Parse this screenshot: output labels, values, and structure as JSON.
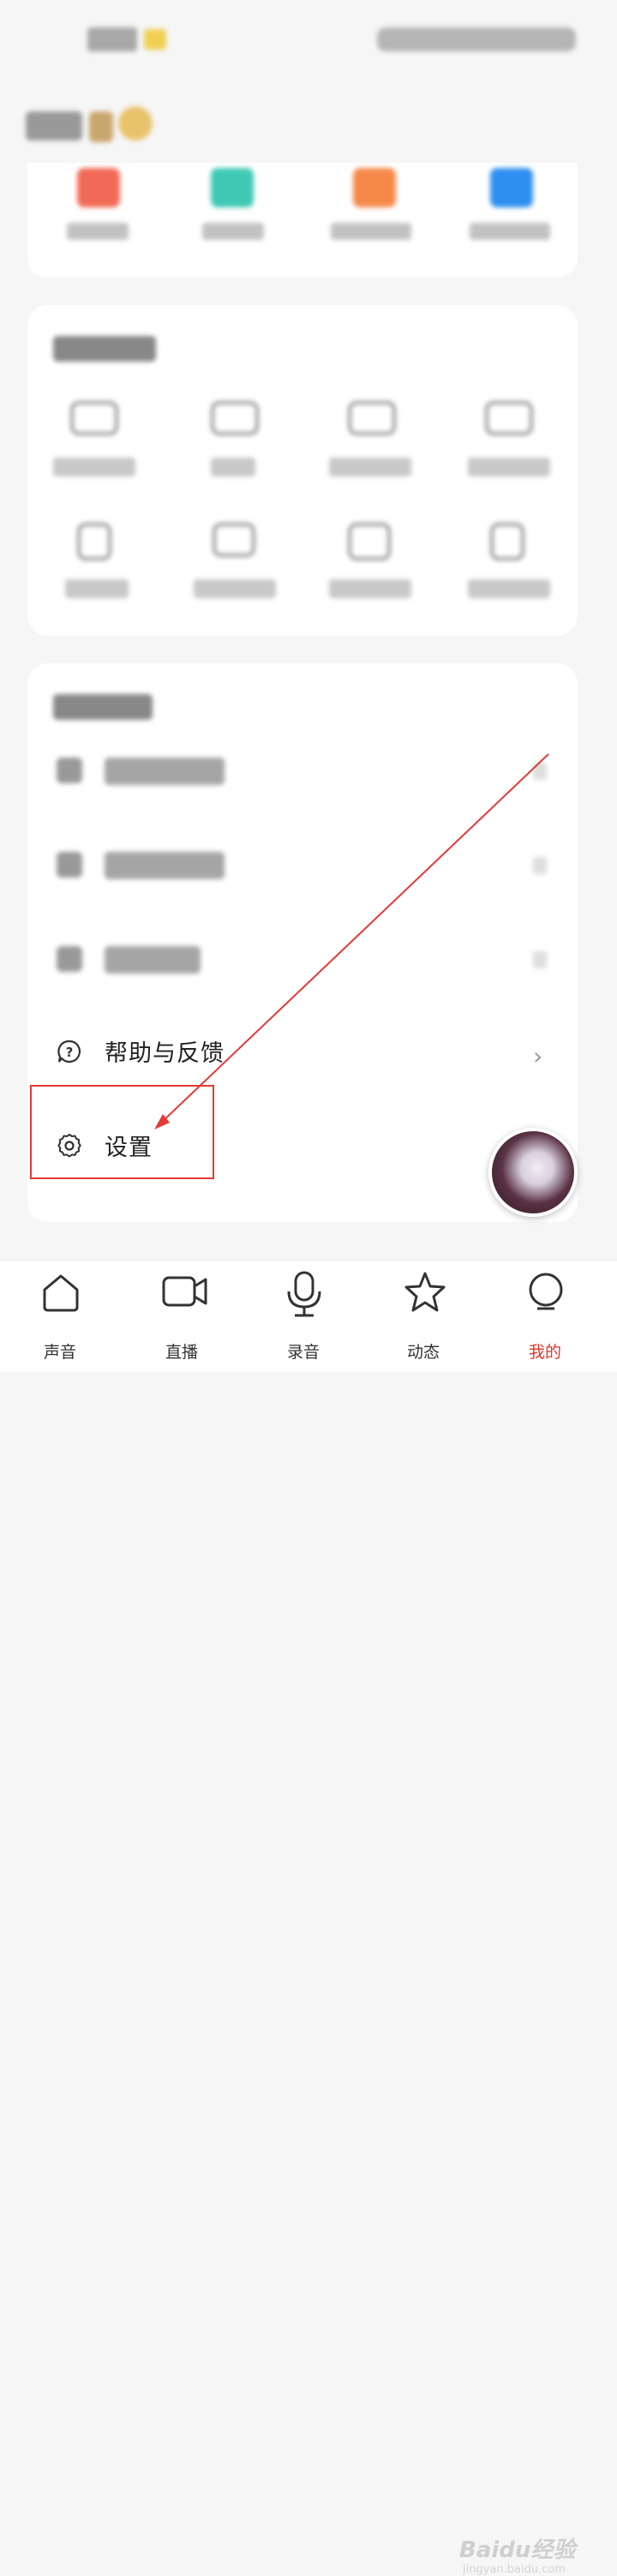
{
  "menu": {
    "help_label": "帮助与反馈",
    "settings_label": "设置"
  },
  "tabs": [
    {
      "label": "声音",
      "icon": "home-icon"
    },
    {
      "label": "直播",
      "icon": "video-camera-icon"
    },
    {
      "label": "录音",
      "icon": "microphone-icon"
    },
    {
      "label": "动态",
      "icon": "star-icon"
    },
    {
      "label": "我的",
      "icon": "profile-icon",
      "active": true
    }
  ],
  "watermark": {
    "brand": "Baidu经验",
    "url": "jingyan.baidu.com"
  },
  "colors": {
    "active_tab": "#e0362c",
    "highlight": "#e53935"
  }
}
